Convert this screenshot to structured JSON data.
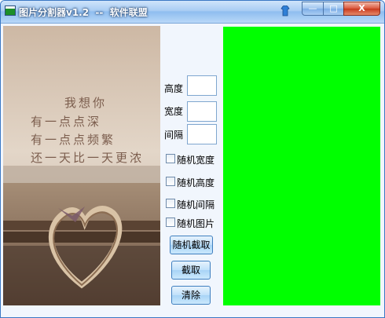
{
  "window": {
    "title": "图片分割器v1.2  --  软件联盟"
  },
  "titlebar_buttons": {
    "minimize": "—",
    "maximize": "□",
    "close": "X"
  },
  "image_poem": {
    "line1": "我想你",
    "line2": "有一点点深",
    "line3": "有一点点频繁",
    "line4": "还一天比一天更浓"
  },
  "form": {
    "height_label": "高度",
    "height_value": "",
    "width_label": "宽度",
    "width_value": "",
    "gap_label": "间隔",
    "gap_value": ""
  },
  "checkboxes": [
    {
      "label": "随机宽度",
      "checked": false
    },
    {
      "label": "随机高度",
      "checked": false
    },
    {
      "label": "随机间隔",
      "checked": false
    },
    {
      "label": "随机图片",
      "checked": false
    }
  ],
  "buttons": {
    "random_crop": "随机截取",
    "crop": "截取",
    "clear": "清除"
  },
  "colors": {
    "preview": "#00ff00",
    "titlebar": "#a9cdf3"
  }
}
